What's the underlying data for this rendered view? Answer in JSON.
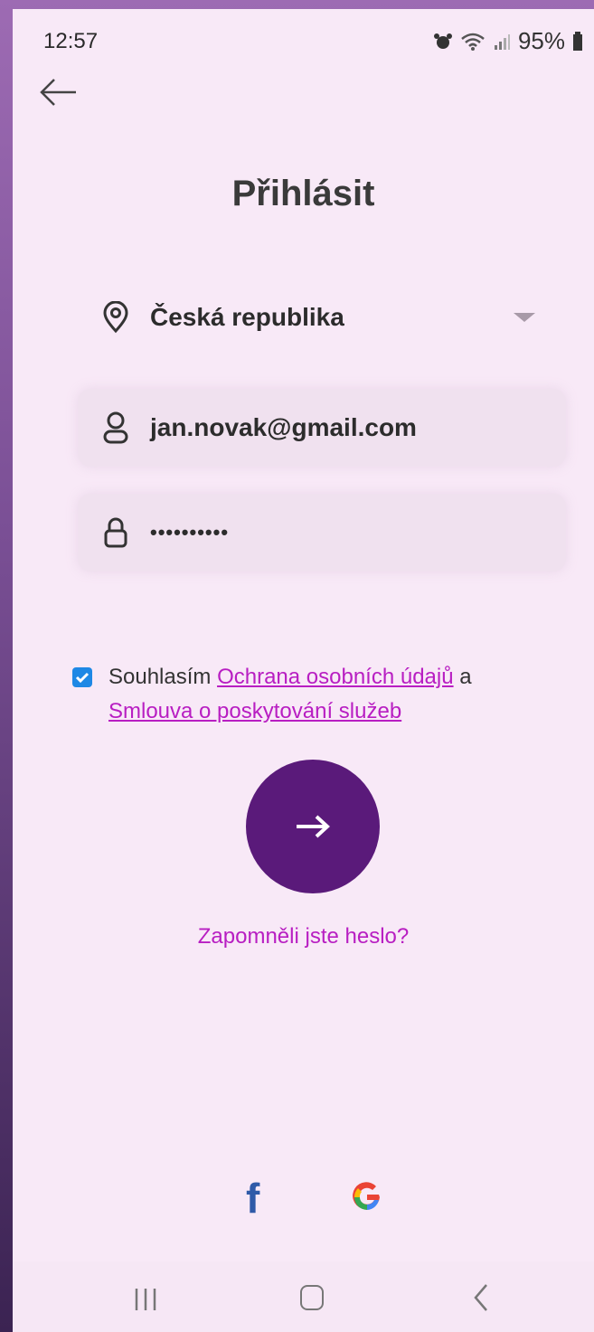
{
  "status": {
    "time": "12:57",
    "battery": "95%"
  },
  "title": "Přihlásit",
  "country": {
    "value": "Česká republika"
  },
  "email": {
    "value": "jan.novak@gmail.com"
  },
  "password": {
    "value": "••••••••••"
  },
  "agreement": {
    "prefix": "Souhlasím",
    "privacy_link": "Ochrana osobních údajů",
    "conjunction": "a",
    "terms_link": "Smlouva o poskytování služeb",
    "checked": true
  },
  "forgot_password": "Zapomněli jste heslo?",
  "social": {
    "facebook_glyph": "f",
    "google_glyph": "G"
  },
  "colors": {
    "background": "#f8e9f7",
    "primary": "#5a1a7a",
    "link": "#b81ec2",
    "checkbox": "#1e88e5"
  }
}
